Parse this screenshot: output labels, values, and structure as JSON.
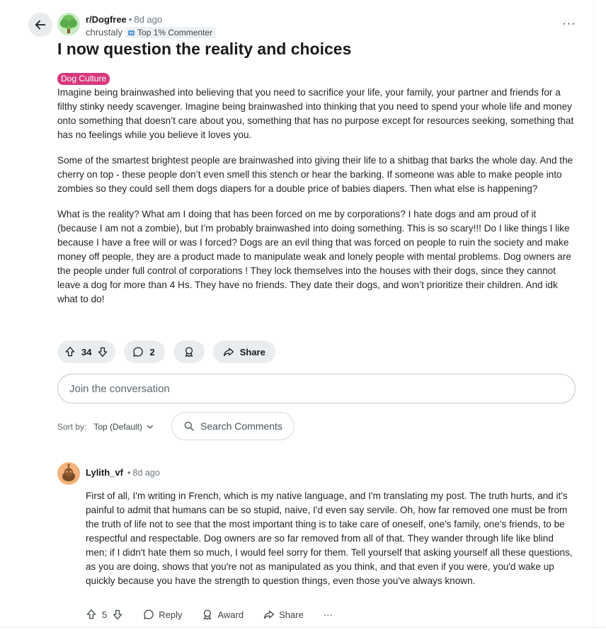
{
  "post": {
    "subreddit": "r/Dogfree",
    "age": "8d ago",
    "author": "chrustaly",
    "author_badge": "Top 1% Commenter",
    "title": "I now question the reality and choices",
    "flair": "Dog Culture",
    "paragraphs": [
      "Imagine being brainwashed into believing that you need to sacrifice your life, your family, your partner and friends for a filthy stinky needy scavenger. Imagine being brainwashed into thinking that you need to spend your whole life and money onto something that doesn’t care about you, something that has no purpose except for resources seeking, something that has no feelings while you believe it loves you.",
      "Some of the smartest brightest people are brainwashed into giving their life to a shitbag that barks the whole day. And the cherry on top - these people don’t even smell this stench or hear the barking. If someone was able to make people into zombies so they could sell them dogs diapers for a double price of babies diapers. Then what else is happening?",
      "What is the reality? What am I doing that has been forced on me by corporations? I hate dogs and am proud of it (because I am not a zombie), but I’m probably brainwashed into doing something. This is so scary!!! Do I like things I like because I have a free will or was I forced? Dogs are an evil thing that was forced on people to ruin the society and make money off people, they are a product made to manipulate weak and lonely people with mental problems. Dog owners are the people under full control of corporations ! They lock themselves into the houses with their dogs, since they cannot leave a dog for more than 4 Hs. They have no friends. They date their dogs, and won’t prioritize their children. And idk what to do!"
    ],
    "votes": "34",
    "comments": "2",
    "share_label": "Share"
  },
  "join_placeholder": "Join the conversation",
  "sort": {
    "label": "Sort by:",
    "value": "Top (Default)",
    "search_placeholder": "Search Comments"
  },
  "comment": {
    "user": "Lylith_vf",
    "age": "8d ago",
    "text": "First of all, I'm writing in French, which is my native language, and I'm translating my post. The truth hurts, and it's painful to admit that humans can be so stupid, naive, I'd even say servile. Oh, how far removed one must be from the truth of life not to see that the most important thing is to take care of oneself, one's family, one's friends, to be respectful and respectable. Dog owners are so far removed from all of that. They wander through life like blind men; if I didn't hate them so much, I would feel sorry for them. Tell yourself that asking yourself all these questions, as you are doing, shows that you're not as manipulated as you think, and that even if you were, you'd wake up quickly because you have the strength to question things, even those you've always known.",
    "votes": "5",
    "reply_label": "Reply",
    "award_label": "Award",
    "share_label": "Share",
    "more": "···"
  },
  "more_label": "···",
  "colors": {
    "flair_bg": "#d6397e",
    "pill_bg": "#eaedef",
    "muted_text": "#6b7780"
  }
}
